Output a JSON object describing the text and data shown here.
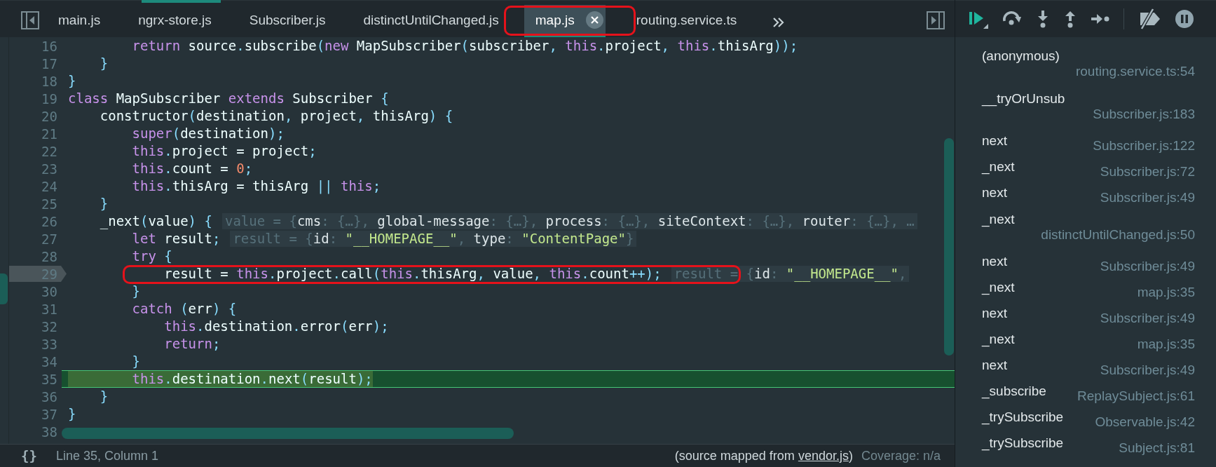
{
  "editor_tabs": [
    {
      "label": "main.js",
      "selected": false,
      "annotated": false
    },
    {
      "label": "ngrx-store.js",
      "selected": false,
      "annotated": false
    },
    {
      "label": "Subscriber.js",
      "selected": false,
      "annotated": false
    },
    {
      "label": "distinctUntilChanged.js",
      "selected": false,
      "annotated": false
    },
    {
      "label": "map.js",
      "selected": true,
      "annotated": true
    },
    {
      "label": "routing.service.ts",
      "selected": false,
      "annotated": false
    }
  ],
  "code": {
    "lines": [
      {
        "number": "16",
        "current": false,
        "breakpoint": false,
        "annotated": false,
        "tokens": [
          {
            "kind": "kw",
            "text": "        return"
          },
          {
            "kind": "id",
            "text": " source"
          },
          {
            "kind": "op",
            "text": "."
          },
          {
            "kind": "id",
            "text": "subscribe"
          },
          {
            "kind": "op",
            "text": "("
          },
          {
            "kind": "kw",
            "text": "new"
          },
          {
            "kind": "id",
            "text": " MapSubscriber"
          },
          {
            "kind": "op",
            "text": "("
          },
          {
            "kind": "id",
            "text": "subscriber"
          },
          {
            "kind": "op",
            "text": ", "
          },
          {
            "kind": "kw",
            "text": "this"
          },
          {
            "kind": "op",
            "text": "."
          },
          {
            "kind": "id",
            "text": "project"
          },
          {
            "kind": "op",
            "text": ", "
          },
          {
            "kind": "kw",
            "text": "this"
          },
          {
            "kind": "op",
            "text": "."
          },
          {
            "kind": "id",
            "text": "thisArg"
          },
          {
            "kind": "op",
            "text": "));"
          }
        ]
      },
      {
        "number": "17",
        "current": false,
        "breakpoint": false,
        "annotated": false,
        "tokens": [
          {
            "kind": "op",
            "text": "    }"
          }
        ]
      },
      {
        "number": "18",
        "current": false,
        "breakpoint": false,
        "annotated": false,
        "tokens": [
          {
            "kind": "op",
            "text": "}"
          }
        ]
      },
      {
        "number": "19",
        "current": false,
        "breakpoint": false,
        "annotated": false,
        "tokens": [
          {
            "kind": "kw",
            "text": "class"
          },
          {
            "kind": "id",
            "text": " MapSubscriber "
          },
          {
            "kind": "kw",
            "text": "extends"
          },
          {
            "kind": "id",
            "text": " Subscriber "
          },
          {
            "kind": "op",
            "text": "{"
          }
        ]
      },
      {
        "number": "20",
        "current": false,
        "breakpoint": false,
        "annotated": false,
        "tokens": [
          {
            "kind": "id",
            "text": "    constructor"
          },
          {
            "kind": "op",
            "text": "("
          },
          {
            "kind": "id",
            "text": "destination"
          },
          {
            "kind": "op",
            "text": ", "
          },
          {
            "kind": "id",
            "text": "project"
          },
          {
            "kind": "op",
            "text": ", "
          },
          {
            "kind": "id",
            "text": "thisArg"
          },
          {
            "kind": "op",
            "text": ") {"
          }
        ]
      },
      {
        "number": "21",
        "current": false,
        "breakpoint": false,
        "annotated": false,
        "tokens": [
          {
            "kind": "kw",
            "text": "        super"
          },
          {
            "kind": "op",
            "text": "("
          },
          {
            "kind": "id",
            "text": "destination"
          },
          {
            "kind": "op",
            "text": ");"
          }
        ]
      },
      {
        "number": "22",
        "current": false,
        "breakpoint": false,
        "annotated": false,
        "tokens": [
          {
            "kind": "kw",
            "text": "        this"
          },
          {
            "kind": "op",
            "text": "."
          },
          {
            "kind": "id",
            "text": "project = project"
          },
          {
            "kind": "op",
            "text": ";"
          }
        ]
      },
      {
        "number": "23",
        "current": false,
        "breakpoint": false,
        "annotated": false,
        "tokens": [
          {
            "kind": "kw",
            "text": "        this"
          },
          {
            "kind": "op",
            "text": "."
          },
          {
            "kind": "id",
            "text": "count = "
          },
          {
            "kind": "num",
            "text": "0"
          },
          {
            "kind": "op",
            "text": ";"
          }
        ]
      },
      {
        "number": "24",
        "current": false,
        "breakpoint": false,
        "annotated": false,
        "tokens": [
          {
            "kind": "kw",
            "text": "        this"
          },
          {
            "kind": "op",
            "text": "."
          },
          {
            "kind": "id",
            "text": "thisArg = thisArg "
          },
          {
            "kind": "op",
            "text": "|| "
          },
          {
            "kind": "kw",
            "text": "this"
          },
          {
            "kind": "op",
            "text": ";"
          }
        ]
      },
      {
        "number": "25",
        "current": false,
        "breakpoint": false,
        "annotated": false,
        "tokens": [
          {
            "kind": "op",
            "text": "    }"
          }
        ]
      },
      {
        "number": "26",
        "current": false,
        "breakpoint": false,
        "annotated": false,
        "tokens": [
          {
            "kind": "id",
            "text": "    _next"
          },
          {
            "kind": "op",
            "text": "("
          },
          {
            "kind": "id",
            "text": "value"
          },
          {
            "kind": "op",
            "text": ") {"
          }
        ],
        "hint": [
          {
            "kind": "dim",
            "text": "value = {"
          },
          {
            "kind": "key",
            "text": "cms"
          },
          {
            "kind": "dim",
            "text": ": {…}, "
          },
          {
            "kind": "key",
            "text": "global-message"
          },
          {
            "kind": "dim",
            "text": ": {…}, "
          },
          {
            "kind": "key",
            "text": "process"
          },
          {
            "kind": "dim",
            "text": ": {…}, "
          },
          {
            "kind": "key",
            "text": "siteContext"
          },
          {
            "kind": "dim",
            "text": ": {…}, "
          },
          {
            "kind": "key",
            "text": "router"
          },
          {
            "kind": "dim",
            "text": ": {…}, …"
          }
        ]
      },
      {
        "number": "27",
        "current": false,
        "breakpoint": false,
        "annotated": false,
        "tokens": [
          {
            "kind": "kw",
            "text": "        let"
          },
          {
            "kind": "id",
            "text": " result"
          },
          {
            "kind": "op",
            "text": ";"
          }
        ],
        "hint": [
          {
            "kind": "dim",
            "text": "result = {"
          },
          {
            "kind": "key",
            "text": "id"
          },
          {
            "kind": "dim",
            "text": ": "
          },
          {
            "kind": "str",
            "text": "\"__HOMEPAGE__\""
          },
          {
            "kind": "dim",
            "text": ", "
          },
          {
            "kind": "key",
            "text": "type"
          },
          {
            "kind": "dim",
            "text": ": "
          },
          {
            "kind": "str",
            "text": "\"ContentPage\""
          },
          {
            "kind": "dim",
            "text": "}"
          }
        ]
      },
      {
        "number": "28",
        "current": false,
        "breakpoint": false,
        "annotated": false,
        "tokens": [
          {
            "kind": "kw",
            "text": "        try"
          },
          {
            "kind": "op",
            "text": " {"
          }
        ]
      },
      {
        "number": "29",
        "current": false,
        "breakpoint": true,
        "annotated": true,
        "tokens": [
          {
            "kind": "id",
            "text": "            result = "
          },
          {
            "kind": "kw",
            "text": "this"
          },
          {
            "kind": "op",
            "text": "."
          },
          {
            "kind": "id",
            "text": "project"
          },
          {
            "kind": "op",
            "text": "."
          },
          {
            "kind": "id",
            "text": "call"
          },
          {
            "kind": "op",
            "text": "("
          },
          {
            "kind": "kw",
            "text": "this"
          },
          {
            "kind": "op",
            "text": "."
          },
          {
            "kind": "id",
            "text": "thisArg"
          },
          {
            "kind": "op",
            "text": ", "
          },
          {
            "kind": "id",
            "text": "value"
          },
          {
            "kind": "op",
            "text": ", "
          },
          {
            "kind": "kw",
            "text": "this"
          },
          {
            "kind": "op",
            "text": "."
          },
          {
            "kind": "id",
            "text": "count"
          },
          {
            "kind": "op",
            "text": "++);"
          }
        ],
        "hint": [
          {
            "kind": "dim",
            "text": "result = {"
          },
          {
            "kind": "key",
            "text": "id"
          },
          {
            "kind": "dim",
            "text": ": "
          },
          {
            "kind": "str",
            "text": "\"__HOMEPAGE__\""
          },
          {
            "kind": "dim",
            "text": ","
          }
        ]
      },
      {
        "number": "30",
        "current": false,
        "breakpoint": false,
        "annotated": false,
        "tokens": [
          {
            "kind": "op",
            "text": "        }"
          }
        ]
      },
      {
        "number": "31",
        "current": false,
        "breakpoint": false,
        "annotated": false,
        "tokens": [
          {
            "kind": "kw",
            "text": "        catch"
          },
          {
            "kind": "op",
            "text": " ("
          },
          {
            "kind": "id",
            "text": "err"
          },
          {
            "kind": "op",
            "text": ") {"
          }
        ]
      },
      {
        "number": "32",
        "current": false,
        "breakpoint": false,
        "annotated": false,
        "tokens": [
          {
            "kind": "kw",
            "text": "            this"
          },
          {
            "kind": "op",
            "text": "."
          },
          {
            "kind": "id",
            "text": "destination"
          },
          {
            "kind": "op",
            "text": "."
          },
          {
            "kind": "id",
            "text": "error"
          },
          {
            "kind": "op",
            "text": "("
          },
          {
            "kind": "id",
            "text": "err"
          },
          {
            "kind": "op",
            "text": ");"
          }
        ]
      },
      {
        "number": "33",
        "current": false,
        "breakpoint": false,
        "annotated": false,
        "tokens": [
          {
            "kind": "kw",
            "text": "            return"
          },
          {
            "kind": "op",
            "text": ";"
          }
        ]
      },
      {
        "number": "34",
        "current": false,
        "breakpoint": false,
        "annotated": false,
        "tokens": [
          {
            "kind": "op",
            "text": "        }"
          }
        ]
      },
      {
        "number": "35",
        "current": true,
        "breakpoint": false,
        "annotated": false,
        "tokens": [
          {
            "kind": "kw",
            "text": "        this"
          },
          {
            "kind": "op",
            "text": "."
          },
          {
            "kind": "id",
            "text": "destination"
          },
          {
            "kind": "op",
            "text": "."
          },
          {
            "kind": "id",
            "text": "next"
          },
          {
            "kind": "op",
            "text": "("
          },
          {
            "kind": "id",
            "text": "result"
          },
          {
            "kind": "op",
            "text": ");"
          }
        ]
      },
      {
        "number": "36",
        "current": false,
        "breakpoint": false,
        "annotated": false,
        "tokens": [
          {
            "kind": "op",
            "text": "    }"
          }
        ]
      },
      {
        "number": "37",
        "current": false,
        "breakpoint": false,
        "annotated": false,
        "tokens": [
          {
            "kind": "op",
            "text": "}"
          }
        ]
      },
      {
        "number": "38",
        "current": false,
        "breakpoint": false,
        "annotated": false
      }
    ]
  },
  "status_bar": {
    "format_button": "{}",
    "cursor_position": "Line 35, Column 1",
    "source_note_start": "(source mapped from ",
    "source_link": "vendor.js",
    "source_note_end": ")",
    "coverage": "Coverage: n/a"
  },
  "call_stack": [
    {
      "name": "(anonymous)",
      "location": "routing.service.ts:54",
      "kind": "two-line"
    },
    {
      "name": "__tryOrUnsub",
      "location": "Subscriber.js:183",
      "kind": "two-line"
    },
    {
      "name": "next",
      "location": "Subscriber.js:122",
      "kind": "one-line"
    },
    {
      "name": "_next",
      "location": "Subscriber.js:72",
      "kind": "one-line"
    },
    {
      "name": "next",
      "location": "Subscriber.js:49",
      "kind": "one-line"
    },
    {
      "name": "_next",
      "location": "distinctUntilChanged.js:50",
      "kind": "two-line"
    },
    {
      "name": "next",
      "location": "Subscriber.js:49",
      "kind": "one-line"
    },
    {
      "name": "_next",
      "location": "map.js:35",
      "kind": "one-line"
    },
    {
      "name": "next",
      "location": "Subscriber.js:49",
      "kind": "one-line"
    },
    {
      "name": "_next",
      "location": "map.js:35",
      "kind": "one-line"
    },
    {
      "name": "next",
      "location": "Subscriber.js:49",
      "kind": "one-line"
    },
    {
      "name": "_subscribe",
      "location": "ReplaySubject.js:61",
      "kind": "one-line"
    },
    {
      "name": "_trySubscribe",
      "location": "Observable.js:42",
      "kind": "one-line"
    },
    {
      "name": "_trySubscribe",
      "location": "Subject.js:81",
      "kind": "one-line"
    }
  ]
}
